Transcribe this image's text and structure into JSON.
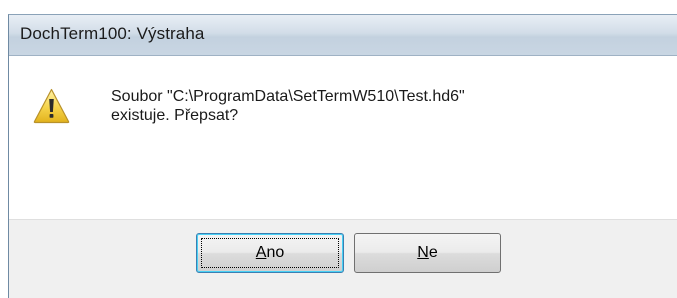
{
  "window": {
    "title": "DochTerm100: Výstraha"
  },
  "dialog": {
    "icon": "warning-icon",
    "message_line1": "Soubor \"C:\\ProgramData\\SetTermW510\\Test.hd6\"",
    "message_line2": "existuje. Přepsat?"
  },
  "buttons": {
    "yes": {
      "accel": "A",
      "rest": "no"
    },
    "no": {
      "accel": "N",
      "rest": "e"
    }
  },
  "colors": {
    "titlebar": "#c9d6e3",
    "warning_fill": "#f5d34a",
    "focus_border": "#3c7fb1"
  }
}
